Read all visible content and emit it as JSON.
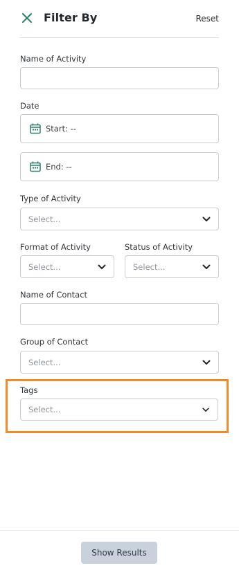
{
  "header": {
    "title": "Filter By",
    "reset_label": "Reset",
    "close_icon": "close-icon"
  },
  "fields": {
    "name_of_activity": {
      "label": "Name of Activity",
      "value": ""
    },
    "date": {
      "label": "Date",
      "start_text": "Start: --",
      "end_text": "End: --",
      "icon": "calendar-icon"
    },
    "type_of_activity": {
      "label": "Type of Activity",
      "placeholder": "Select..."
    },
    "format_of_activity": {
      "label": "Format of Activity",
      "placeholder": "Select..."
    },
    "status_of_activity": {
      "label": "Status of Activity",
      "placeholder": "Select..."
    },
    "name_of_contact": {
      "label": "Name of Contact",
      "value": ""
    },
    "group_of_contact": {
      "label": "Group of Contact",
      "placeholder": "Select..."
    },
    "tags": {
      "label": "Tags",
      "placeholder": "Select..."
    }
  },
  "footer": {
    "show_results_label": "Show Results"
  },
  "colors": {
    "accent": "#2e7d6b",
    "highlight": "#f08a2b",
    "button_bg": "#c9d2dc"
  }
}
